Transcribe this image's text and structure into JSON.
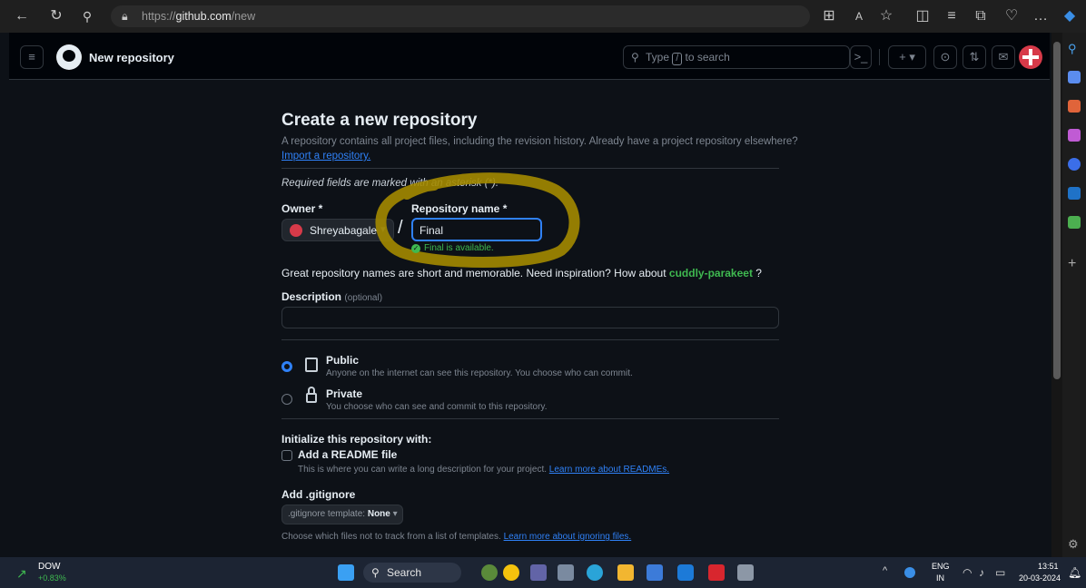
{
  "browser": {
    "url_scheme": "https://",
    "url_host": "github.com",
    "url_path": "/new"
  },
  "header": {
    "title": "New repository",
    "search_placeholder_prefix": "Type",
    "search_key": "/",
    "search_placeholder_suffix": "to search",
    "create_plus": "+",
    "create_caret": "▾"
  },
  "form": {
    "heading": "Create a new repository",
    "intro": "A repository contains all project files, including the revision history. Already have a project repository elsewhere?",
    "import_link": "Import a repository.",
    "required_note": "Required fields are marked with an asterisk (*).",
    "owner_label": "Owner *",
    "owner_value": "Shreyabagale",
    "slash": "/",
    "repo_label": "Repository name *",
    "repo_value": "Final",
    "available_msg": "Final is available.",
    "suggest_prefix": "Great repository names are short and memorable. Need inspiration? How about",
    "suggest_name": "cuddly-parakeet",
    "suggest_suffix": "?",
    "description_label": "Description",
    "description_optional": "(optional)",
    "description_value": "",
    "visibility": {
      "public_label": "Public",
      "public_desc": "Anyone on the internet can see this repository. You choose who can commit.",
      "private_label": "Private",
      "private_desc": "You choose who can see and commit to this repository.",
      "selected": "Public"
    },
    "init_heading": "Initialize this repository with:",
    "readme_label": "Add a README file",
    "readme_desc": "This is where you can write a long description for your project.",
    "readme_link": "Learn more about READMEs.",
    "gitignore_heading": "Add .gitignore",
    "gitignore_select_prefix": ".gitignore template:",
    "gitignore_select_value": "None",
    "gitignore_desc": "Choose which files not to track from a list of templates.",
    "gitignore_link": "Learn more about ignoring files."
  },
  "taskbar": {
    "stock_name": "DOW",
    "stock_change": "+0.83%",
    "search_label": "Search",
    "lang_top": "ENG",
    "lang_bottom": "IN",
    "time": "13:51",
    "date": "20-03-2024"
  },
  "colors": {
    "accent_blue": "#2f81f7",
    "success_green": "#3fb950",
    "highlight_gold": "#a38a00"
  }
}
